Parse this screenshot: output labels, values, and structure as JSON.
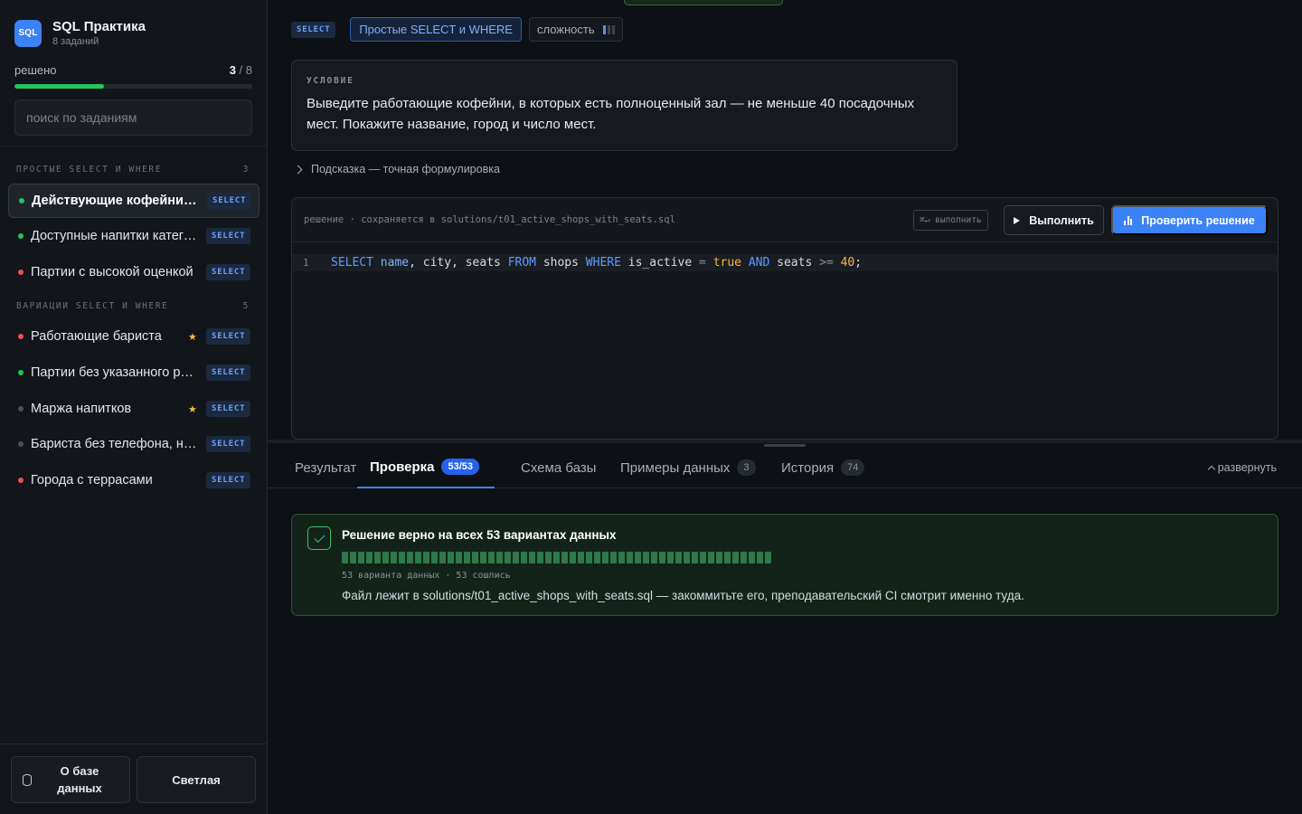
{
  "app": {
    "logo_text": "SQL",
    "title": "SQL Практика",
    "subtitle": "8 заданий"
  },
  "progress": {
    "label": "решено",
    "solved": "3",
    "sep_total": " / 8",
    "fraction": 0.375
  },
  "search": {
    "placeholder": "поиск по заданиям"
  },
  "groups": [
    {
      "title": "простые select и where",
      "count": "3",
      "tasks": [
        {
          "name": "Действующие кофейни с залом",
          "status": "green",
          "badge": "SELECT",
          "active": true,
          "starred": false
        },
        {
          "name": "Доступные напитки категории",
          "status": "green",
          "badge": "SELECT",
          "active": false,
          "starred": false
        },
        {
          "name": "Партии с высокой оценкой",
          "status": "red",
          "badge": "SELECT",
          "active": false,
          "starred": false
        }
      ]
    },
    {
      "title": "вариации select и where",
      "count": "5",
      "tasks": [
        {
          "name": "Работающие бариста",
          "status": "red",
          "badge": "SELECT",
          "active": false,
          "starred": true
        },
        {
          "name": "Партии без указанного региона",
          "status": "green",
          "badge": "SELECT",
          "active": false,
          "starred": false
        },
        {
          "name": "Маржа напитков",
          "status": "gray",
          "badge": "SELECT",
          "active": false,
          "starred": true
        },
        {
          "name": "Бариста без телефона, но с email",
          "status": "gray",
          "badge": "SELECT",
          "active": false,
          "starred": false
        },
        {
          "name": "Города с террасами",
          "status": "red",
          "badge": "SELECT",
          "active": false,
          "starred": false
        }
      ]
    }
  ],
  "footer": {
    "db_button": "О базе данных",
    "theme_button": "Светлая"
  },
  "task": {
    "tag": "SELECT",
    "topic": "Простые SELECT и WHERE",
    "difficulty_label": "сложность",
    "difficulty_level": 1,
    "difficulty_max": 3,
    "condition_label": "УСЛОВИЕ",
    "condition": "Выведите работающие кофейни, в которых есть полноценный зал — не меньше 40 посадочных мест. Покажите название, город и число мест.",
    "hint": "Подсказка — точная формулировка"
  },
  "editor": {
    "path": "решение · сохраняется в solutions/t01_active_shops_with_seats.sql",
    "shortcut": "⌘↵ выполнить",
    "run_label": "Выполнить",
    "check_label": "Проверить решение",
    "line_number": "1",
    "code_tokens": [
      {
        "t": "SELECT",
        "c": "kw"
      },
      {
        "t": " ",
        "c": ""
      },
      {
        "t": "name",
        "c": "id"
      },
      {
        "t": ", city, seats ",
        "c": ""
      },
      {
        "t": "FROM",
        "c": "kw"
      },
      {
        "t": " shops ",
        "c": ""
      },
      {
        "t": "WHERE",
        "c": "kw"
      },
      {
        "t": " is_active ",
        "c": ""
      },
      {
        "t": "=",
        "c": "op"
      },
      {
        "t": " ",
        "c": ""
      },
      {
        "t": "true",
        "c": "bool"
      },
      {
        "t": " ",
        "c": ""
      },
      {
        "t": "AND",
        "c": "kw"
      },
      {
        "t": " seats ",
        "c": ""
      },
      {
        "t": ">=",
        "c": "op"
      },
      {
        "t": " ",
        "c": ""
      },
      {
        "t": "40",
        "c": "num"
      },
      {
        "t": ";",
        "c": ""
      }
    ]
  },
  "tabs": [
    {
      "label": "Результат",
      "count": "",
      "active": false
    },
    {
      "label": "Проверка",
      "count": "53/53",
      "active": true
    },
    {
      "label": "Схема базы",
      "count": "",
      "active": false
    },
    {
      "label": "Примеры данных",
      "count": "3",
      "active": false
    },
    {
      "label": "История",
      "count": "74",
      "active": false
    }
  ],
  "expand_label": "развернуть",
  "check_result": {
    "title": "Решение верно на всех 53 вариантах данных",
    "variants_total": 53,
    "variants_passed": 53,
    "meta": "53 варианта данных · 53 сошлись",
    "file_note": "Файл лежит в solutions/t01_active_shops_with_seats.sql — закоммитьте его, преподавательский CI смотрит именно туда."
  },
  "colors": {
    "accent": "#3b82f6",
    "success": "#22c55e",
    "error": "#ef5350",
    "pending": "#4a5059",
    "star": "#f5b93f"
  }
}
